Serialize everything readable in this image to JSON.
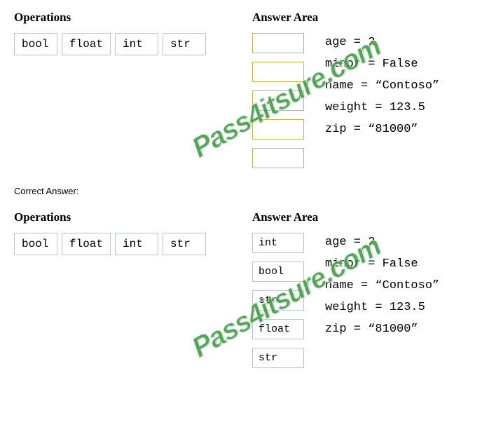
{
  "question": {
    "ops_heading": "Operations",
    "ans_heading": "Answer Area",
    "ops": {
      "bool": "bool",
      "float": "float",
      "int": "int",
      "str": "str"
    },
    "code": {
      "l1": "age = 2",
      "l2": "minor = False",
      "l3": "name = “Contoso”",
      "l4": "weight = 123.5",
      "l5": "zip = “81000”"
    }
  },
  "correct_label": "Correct Answer:",
  "answer": {
    "ops_heading": "Operations",
    "ans_heading": "Answer Area",
    "ops": {
      "bool": "bool",
      "float": "float",
      "int": "int",
      "str": "str"
    },
    "slots": {
      "s1": "int",
      "s2": "bool",
      "s3": "str",
      "s4": "float",
      "s5": "str"
    },
    "code": {
      "l1": "age = 2",
      "l2": "minor = False",
      "l3": "name = “Contoso”",
      "l4": "weight = 123.5",
      "l5": "zip = “81000”"
    }
  },
  "watermark": "Pass4itsure.com"
}
